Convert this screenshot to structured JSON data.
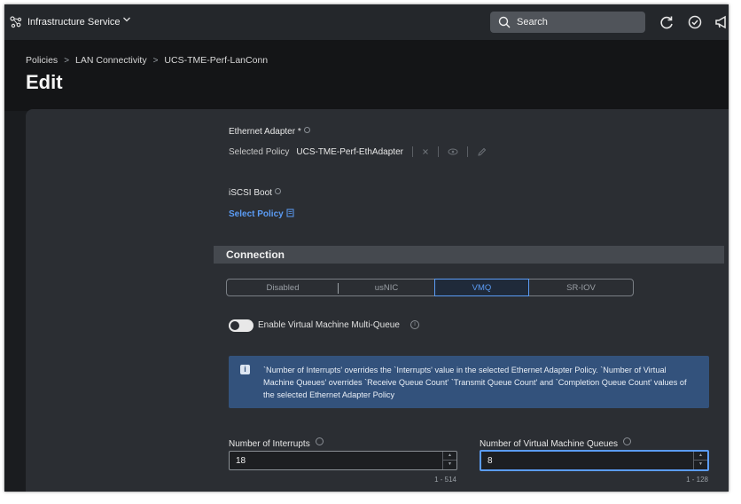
{
  "topbar": {
    "app_title": "Infrastructure Service",
    "search_label": "Search"
  },
  "breadcrumb": {
    "items": [
      "Policies",
      "LAN Connectivity",
      "UCS-TME-Perf-LanConn"
    ],
    "separator": ">"
  },
  "page_title": "Edit",
  "ethernet_adapter": {
    "label": "Ethernet Adapter *",
    "selected_prefix": "Selected Policy",
    "selected_value": "UCS-TME-Perf-EthAdapter"
  },
  "iscsi_boot": {
    "label": "iSCSI Boot",
    "link": "Select Policy"
  },
  "connection": {
    "title": "Connection",
    "options": [
      "Disabled",
      "usNIC",
      "VMQ",
      "SR-IOV"
    ],
    "selected": "VMQ"
  },
  "vmmq": {
    "label": "Enable Virtual Machine Multi-Queue",
    "enabled": false
  },
  "banner": {
    "text": "`Number of Interrupts' overrides the `Interrupts' value in the selected Ethernet Adapter Policy. `Number of Virtual Machine Queues' overrides `Receive Queue Count' `Transmit Queue Count' and `Completion Queue Count' values of the selected Ethernet Adapter Policy"
  },
  "interrupts": {
    "label": "Number of Interrupts",
    "value": "18",
    "range": "1 - 514"
  },
  "vm_queues": {
    "label": "Number of Virtual Machine Queues",
    "value": "8",
    "range": "1 - 128"
  },
  "colors": {
    "accent": "#5b9cf5",
    "banner": "#33527c",
    "panel": "#2b2e33"
  }
}
